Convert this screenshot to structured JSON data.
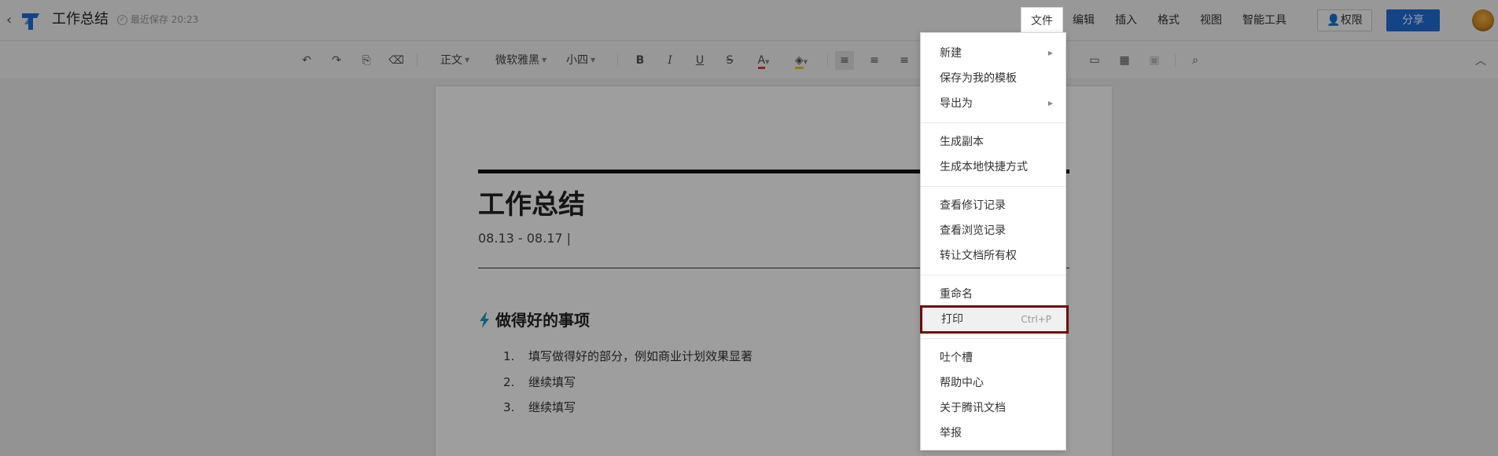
{
  "topbar": {
    "title": "工作总结",
    "save_status": "最近保存 20:23",
    "menus": [
      "文件",
      "编辑",
      "插入",
      "格式",
      "视图",
      "智能工具"
    ],
    "permission_label": "权限",
    "share_label": "分享"
  },
  "toolbar": {
    "style_label": "正文",
    "font_label": "微软雅黑",
    "size_label": "小四",
    "bold": "B",
    "italic": "I",
    "underline": "U",
    "strike": "S",
    "font_color": "A"
  },
  "document": {
    "title": "工作总结",
    "date": "08.13 - 08.17 |",
    "section_title": "做得好的事项",
    "items": [
      {
        "num": "1.",
        "text": "填写做得好的部分，例如商业计划效果显著"
      },
      {
        "num": "2.",
        "text": "继续填写"
      },
      {
        "num": "3.",
        "text": "继续填写"
      }
    ]
  },
  "file_menu": {
    "items": [
      {
        "label": "新建"
      },
      {
        "label": "保存为我的模板"
      },
      {
        "label": "导出为"
      },
      {
        "label": "生成副本"
      },
      {
        "label": "生成本地快捷方式"
      },
      {
        "label": "查看修订记录"
      },
      {
        "label": "查看浏览记录"
      },
      {
        "label": "转让文档所有权"
      },
      {
        "label": "重命名"
      },
      {
        "label": "打印",
        "shortcut": "Ctrl+P"
      },
      {
        "label": "吐个槽"
      },
      {
        "label": "帮助中心"
      },
      {
        "label": "关于腾讯文档"
      },
      {
        "label": "举报"
      }
    ]
  },
  "colors": {
    "accent": "#1e6fd9",
    "highlight_border": "#6b0a0a",
    "section_bolt": "#1aa0c8",
    "font_color_red": "#e53935",
    "fill_color_yellow": "#f5c518"
  }
}
